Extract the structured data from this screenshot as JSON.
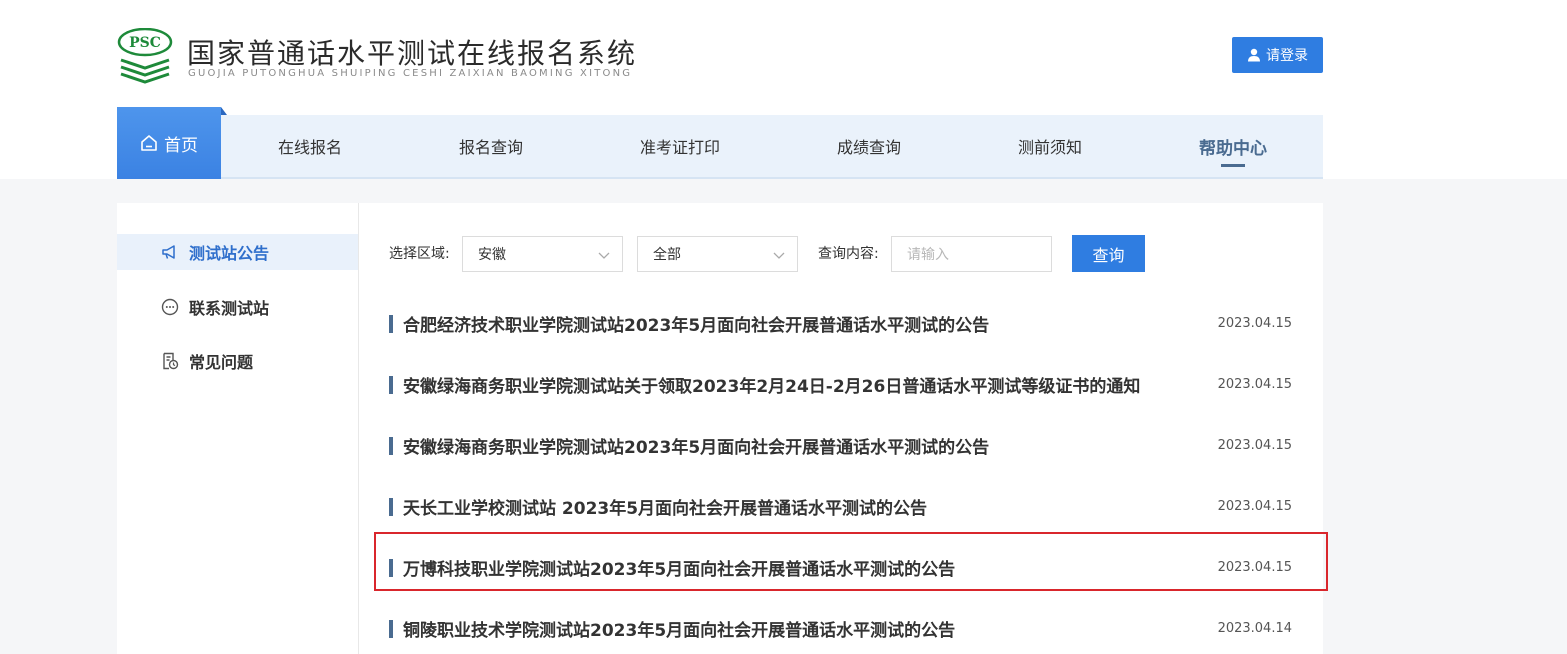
{
  "header": {
    "logo_text": "PSC",
    "title": "国家普通话水平测试在线报名系统",
    "subtitle": "GUOJIA PUTONGHUA SHUIPING CESHI ZAIXIAN BAOMING XITONG",
    "login_label": "请登录",
    "login_icon": "user-icon"
  },
  "nav": {
    "home": "首页",
    "home_icon": "home-icon",
    "items": [
      "在线报名",
      "报名查询",
      "准考证打印",
      "成绩查询",
      "测前须知",
      "帮助中心"
    ],
    "active": "帮助中心"
  },
  "sidebar": {
    "items": [
      {
        "label": "测试站公告",
        "icon": "megaphone-icon",
        "active": true
      },
      {
        "label": "联系测试站",
        "icon": "chat-icon",
        "active": false
      },
      {
        "label": "常见问题",
        "icon": "document-clock-icon",
        "active": false
      }
    ]
  },
  "filters": {
    "region_label": "选择区域:",
    "region_value": "安徽",
    "scope_value": "全部",
    "query_label": "查询内容:",
    "query_placeholder": "请输入",
    "search_label": "查询"
  },
  "notices": [
    {
      "title": "合肥经济技术职业学院测试站2023年5月面向社会开展普通话水平测试的公告",
      "date": "2023.04.15"
    },
    {
      "title": "安徽绿海商务职业学院测试站关于领取2023年2月24日-2月26日普通话水平测试等级证书的通知",
      "date": "2023.04.15"
    },
    {
      "title": "安徽绿海商务职业学院测试站2023年5月面向社会开展普通话水平测试的公告",
      "date": "2023.04.15"
    },
    {
      "title": "天长工业学校测试站 2023年5月面向社会开展普通话水平测试的公告",
      "date": "2023.04.15"
    },
    {
      "title": "万博科技职业学院测试站2023年5月面向社会开展普通话水平测试的公告",
      "date": "2023.04.15"
    },
    {
      "title": "铜陵职业技术学院测试站2023年5月面向社会开展普通话水平测试的公告",
      "date": "2023.04.14"
    }
  ],
  "colors": {
    "accent": "#2f7de1",
    "nav_bg": "#eaf2fb",
    "highlight": "#d9262c"
  }
}
